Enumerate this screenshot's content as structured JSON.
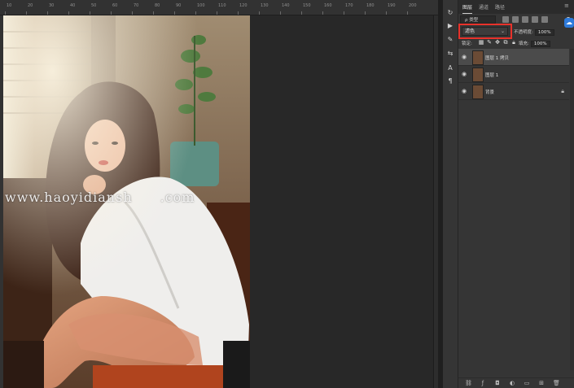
{
  "ruler": {
    "ticks": [
      "10",
      "20",
      "30",
      "40",
      "50",
      "60",
      "70",
      "80",
      "90",
      "100",
      "110",
      "120",
      "130",
      "140",
      "150",
      "160",
      "170",
      "180",
      "190",
      "200"
    ]
  },
  "watermark": "www.haoyidiansh　　.com",
  "panel": {
    "tabs": [
      "图层",
      "通道",
      "路径"
    ],
    "filter_label": "ρ 类型",
    "blend_mode": "滤色",
    "opacity_label": "不透明度:",
    "opacity_value": "100%",
    "lock_label": "锁定:",
    "fill_label": "填充:",
    "fill_value": "100%"
  },
  "layers": [
    {
      "name": "图层 1 拷贝",
      "selected": true
    },
    {
      "name": "图层 1",
      "selected": false
    },
    {
      "name": "背景",
      "selected": false
    }
  ],
  "colors": {
    "accent_highlight": "#e8322b",
    "panel_bg": "#353535",
    "canvas_bg": "#282828",
    "cloud_icon": "#2e7bdc"
  },
  "icons": {
    "tools": [
      "history-icon",
      "play-icon",
      "brush-settings-icon",
      "adjust-icon",
      "character-icon",
      "paragraph-icon"
    ],
    "bottom": [
      "link-icon",
      "fx-icon",
      "mask-icon",
      "adjustment-layer-icon",
      "group-icon",
      "new-layer-icon",
      "trash-icon"
    ]
  }
}
